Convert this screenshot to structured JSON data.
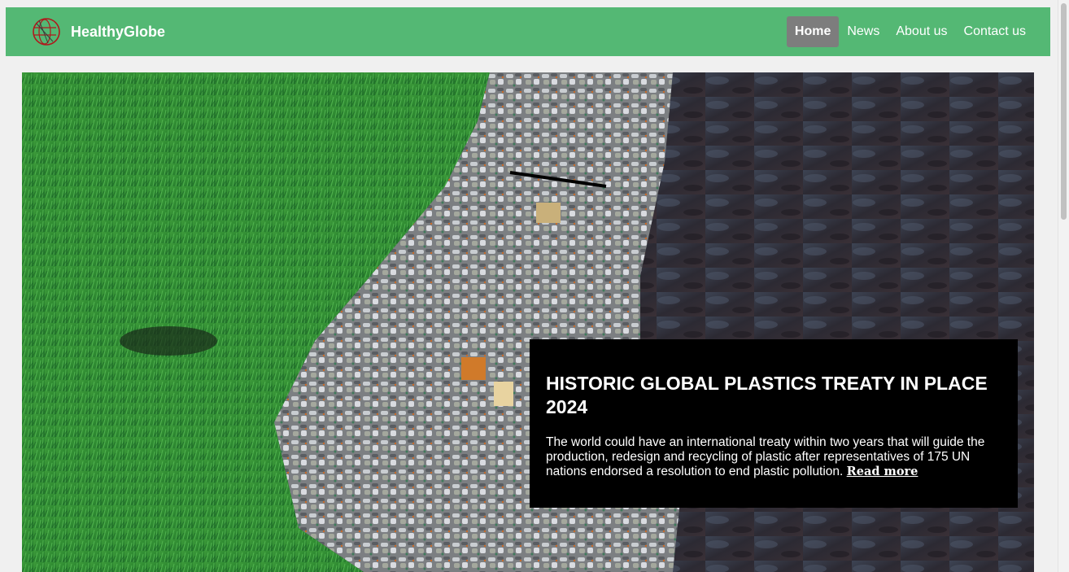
{
  "brand": {
    "name": "HealthyGlobe",
    "logo_icon": "globe-icon",
    "color": "#54b874"
  },
  "nav": {
    "items": [
      {
        "label": "Home",
        "active": true
      },
      {
        "label": "News",
        "active": false
      },
      {
        "label": "About us",
        "active": false
      },
      {
        "label": "Contact us",
        "active": false
      }
    ]
  },
  "hero": {
    "image": "aerial-grass-plastic-waste-water",
    "title": "HISTORIC GLOBAL PLASTICS TREATY IN PLACE 2024",
    "text": "The world could have an international treaty within two years that will guide the production, redesign and recycling of plastic after representatives of 175 UN nations endorsed a resolution to end plastic pollution.",
    "read_more": "Read more"
  }
}
